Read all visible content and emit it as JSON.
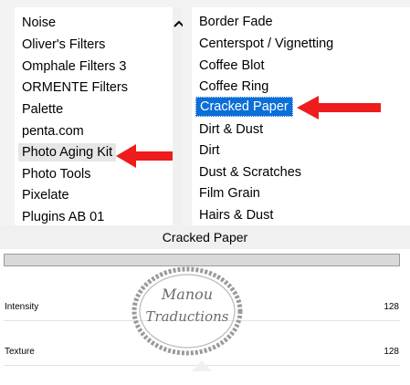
{
  "left_list": {
    "items": [
      {
        "label": "Noise"
      },
      {
        "label": "Oliver's Filters"
      },
      {
        "label": "Omphale Filters 3"
      },
      {
        "label": "ORMENTE Filters"
      },
      {
        "label": "Palette"
      },
      {
        "label": "penta.com"
      },
      {
        "label": "Photo Aging Kit"
      },
      {
        "label": "Photo Tools"
      },
      {
        "label": "Pixelate"
      },
      {
        "label": "Plugins AB 01"
      }
    ]
  },
  "right_list": {
    "items": [
      {
        "label": "Border Fade"
      },
      {
        "label": "Centerspot / Vignetting"
      },
      {
        "label": "Coffee Blot"
      },
      {
        "label": "Coffee Ring"
      },
      {
        "label": "Cracked Paper"
      },
      {
        "label": "Dirt & Dust"
      },
      {
        "label": "Dirt"
      },
      {
        "label": "Dust & Scratches"
      },
      {
        "label": "Film Grain"
      },
      {
        "label": "Hairs & Dust"
      }
    ]
  },
  "filter": {
    "title": "Cracked Paper",
    "params": [
      {
        "label": "Intensity",
        "value": "128"
      },
      {
        "label": "Texture",
        "value": "128"
      }
    ]
  },
  "watermark": {
    "line1": "Manou",
    "line2": "Traductions"
  },
  "colors": {
    "selection": "#0b6fd8",
    "arrow": "#ee1c1c"
  },
  "icons": {
    "scroll_up": "chevron-up-icon",
    "arrow": "red-arrow-icon"
  }
}
